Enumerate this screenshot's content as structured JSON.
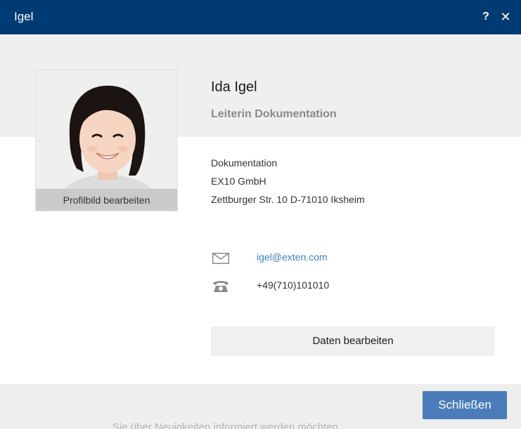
{
  "window": {
    "title": "Igel",
    "help_label": "?",
    "close_label": "✕"
  },
  "profile": {
    "edit_photo_label": "Profilbild bearbeiten",
    "name": "Ida Igel",
    "job_title": "Leiterin Dokumentation",
    "department": "Dokumentation",
    "company": "EX10 GmbH",
    "address": "Zettburger Str. 10 D-71010 Iksheim",
    "email": "igel@exten.com",
    "phone": "+49(710)101010"
  },
  "icons": {
    "email": "envelope-icon",
    "phone": "telephone-icon"
  },
  "actions": {
    "edit_data_label": "Daten bearbeiten",
    "close_label": "Schließen"
  },
  "background": {
    "bleed_text": "Sie über Neuigkeiten informiert werden möchten"
  },
  "colors": {
    "titlebar": "#003b73",
    "primary_button": "#4a7cba",
    "link": "#3f7fc4"
  }
}
